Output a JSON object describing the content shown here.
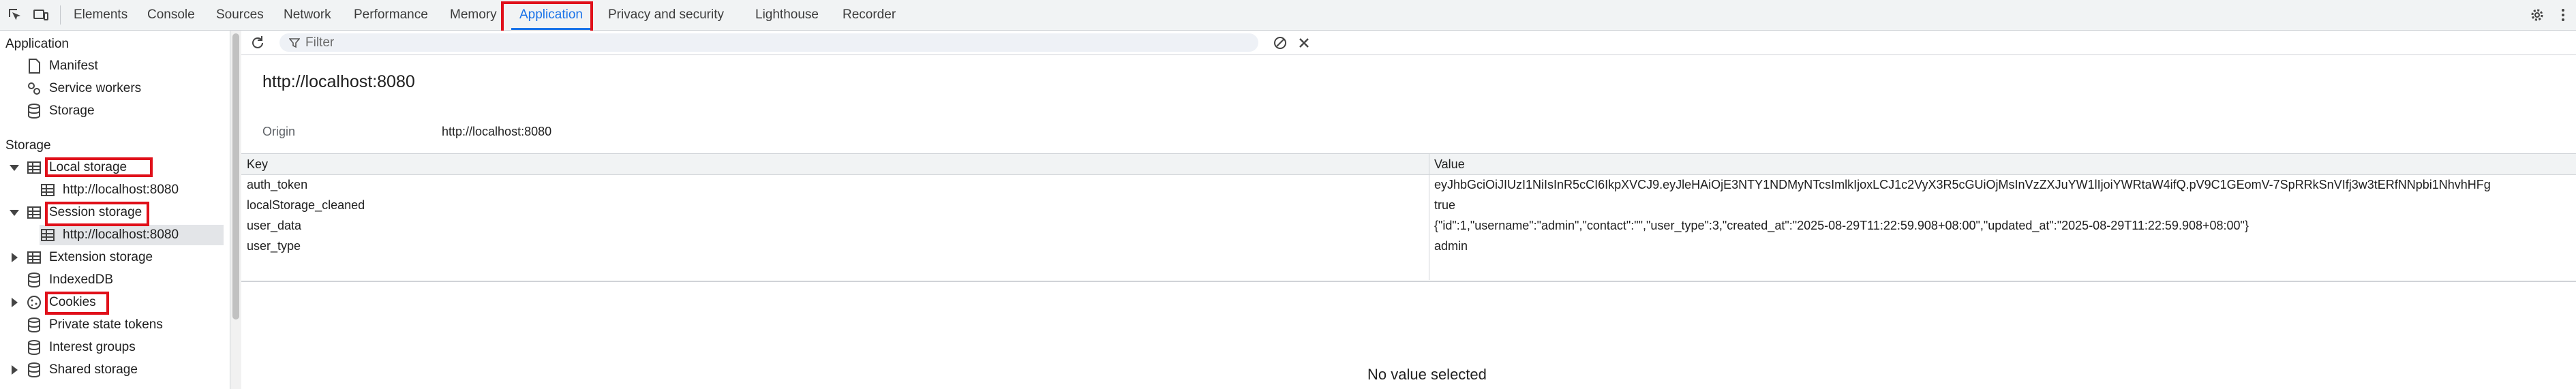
{
  "tabs": [
    {
      "label": "Elements"
    },
    {
      "label": "Console"
    },
    {
      "label": "Sources"
    },
    {
      "label": "Network"
    },
    {
      "label": "Performance"
    },
    {
      "label": "Memory"
    },
    {
      "label": "Application"
    },
    {
      "label": "Privacy and security"
    },
    {
      "label": "Lighthouse"
    },
    {
      "label": "Recorder"
    }
  ],
  "active_tab": "Application",
  "accent_color": "#1a73e8",
  "highlight_color": "#e0101a",
  "sidebar": {
    "application_heading": "Application",
    "application_items": [
      {
        "label": "Manifest",
        "icon": "file-icon"
      },
      {
        "label": "Service workers",
        "icon": "gear-icon"
      },
      {
        "label": "Storage",
        "icon": "database-icon"
      }
    ],
    "storage_heading": "Storage",
    "storage_items": [
      {
        "label": "Local storage",
        "icon": "table-icon",
        "expanded": true
      },
      {
        "label": "http://localhost:8080",
        "icon": "table-icon"
      },
      {
        "label": "Session storage",
        "icon": "table-icon",
        "expanded": true
      },
      {
        "label": "http://localhost:8080",
        "icon": "table-icon"
      },
      {
        "label": "Extension storage",
        "icon": "table-icon",
        "expanded": false
      },
      {
        "label": "IndexedDB",
        "icon": "database-icon"
      },
      {
        "label": "Cookies",
        "icon": "cookie-icon",
        "expanded": false
      },
      {
        "label": "Private state tokens",
        "icon": "database-icon"
      },
      {
        "label": "Interest groups",
        "icon": "database-icon"
      },
      {
        "label": "Shared storage",
        "icon": "database-icon",
        "expanded": false
      }
    ]
  },
  "toolbar": {
    "filter_placeholder": "Filter"
  },
  "main": {
    "origin_title": "http://localhost:8080",
    "origin_label": "Origin",
    "origin_value": "http://localhost:8080",
    "table": {
      "columns": [
        "Key",
        "Value"
      ],
      "rows": [
        {
          "key": "auth_token",
          "value": "eyJhbGciOiJIUzI1NiIsInR5cCI6IkpXVCJ9.eyJleHAiOjE3NTY1NDMyNTcsImlkIjoxLCJ1c2VyX3R5cGUiOjMsInVzZXJuYW1lIjoiYWRtaW4ifQ.pV9C1GEomV-7SpRRkSnVIfj3w3tERfNNpbi1NhvhHFg"
        },
        {
          "key": "localStorage_cleaned",
          "value": "true"
        },
        {
          "key": "user_data",
          "value": "{\"id\":1,\"username\":\"admin\",\"contact\":\"\",\"user_type\":3,\"created_at\":\"2025-08-29T11:22:59.908+08:00\",\"updated_at\":\"2025-08-29T11:22:59.908+08:00\"}"
        },
        {
          "key": "user_type",
          "value": "admin"
        }
      ]
    },
    "empty_message": "No value selected"
  }
}
